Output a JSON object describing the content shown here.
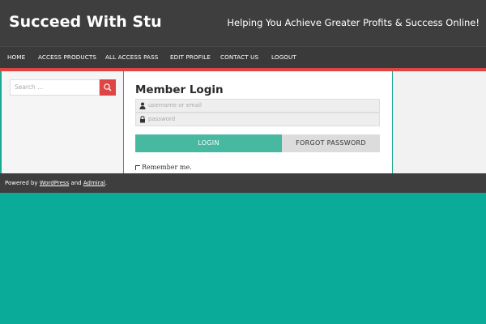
{
  "header": {
    "site_title": "Succeed With Stu",
    "tagline": "Helping You Achieve Greater Profits & Success Online!"
  },
  "nav": {
    "items": [
      {
        "label": "HOME"
      },
      {
        "label": "ACCESS PRODUCTS"
      },
      {
        "label": "ALL ACCESS PASS"
      },
      {
        "label": "EDIT PROFILE"
      },
      {
        "label": "CONTACT US"
      },
      {
        "label": "LOGOUT"
      }
    ]
  },
  "sidebar": {
    "search": {
      "placeholder": "Search ...",
      "icon": "search-icon"
    }
  },
  "login": {
    "title": "Member Login",
    "username_placeholder": "username or email",
    "username_icon": "user-icon",
    "password_placeholder": "password",
    "password_icon": "lock-icon",
    "login_label": "LOGIN",
    "forgot_label": "FORGOT  PASSWORD",
    "remember_label": "Remember me."
  },
  "footer": {
    "prefix": "Powered by ",
    "link1": "WordPress",
    "middle": " and ",
    "link2": "Admiral",
    "suffix": "."
  },
  "colors": {
    "accent_teal": "#0aab99",
    "header_dark": "#3e3e3e",
    "accent_red": "#e04545",
    "button_teal": "#47b9a1"
  }
}
